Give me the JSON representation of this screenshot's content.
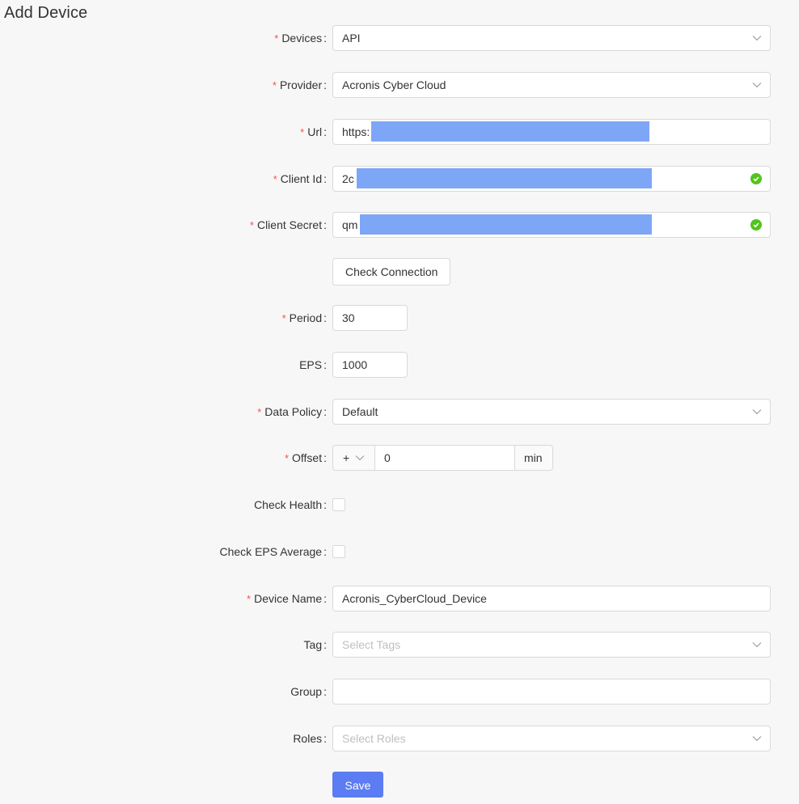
{
  "page": {
    "title": "Add Device"
  },
  "colors": {
    "primary": "#5b7cf2",
    "required": "#ff4d4f",
    "success": "#52c41a",
    "redaction": "#7ea6f7"
  },
  "form": {
    "devices": {
      "label": "Devices",
      "value": "API"
    },
    "provider": {
      "label": "Provider",
      "value": "Acronis Cyber Cloud"
    },
    "url": {
      "label": "Url",
      "value": "https:"
    },
    "client_id": {
      "label": "Client Id",
      "value": "2c"
    },
    "client_secret": {
      "label": "Client Secret",
      "value": "qm"
    },
    "check_connection": {
      "label": "Check Connection"
    },
    "period": {
      "label": "Period",
      "value": "30"
    },
    "eps": {
      "label": "EPS",
      "value": "1000"
    },
    "data_policy": {
      "label": "Data Policy",
      "value": "Default"
    },
    "offset": {
      "label": "Offset",
      "sign": "+",
      "value": "0",
      "unit": "min"
    },
    "check_health": {
      "label": "Check Health",
      "checked": false
    },
    "check_eps_average": {
      "label": "Check EPS Average",
      "checked": false
    },
    "device_name": {
      "label": "Device Name",
      "value": "Acronis_CyberCloud_Device"
    },
    "tag": {
      "label": "Tag",
      "placeholder": "Select Tags"
    },
    "group": {
      "label": "Group",
      "value": ""
    },
    "roles": {
      "label": "Roles",
      "placeholder": "Select Roles"
    },
    "save": {
      "label": "Save"
    }
  },
  "icons": {
    "select_arrow": "chevron-down-icon",
    "validated": "check-circle-icon"
  }
}
